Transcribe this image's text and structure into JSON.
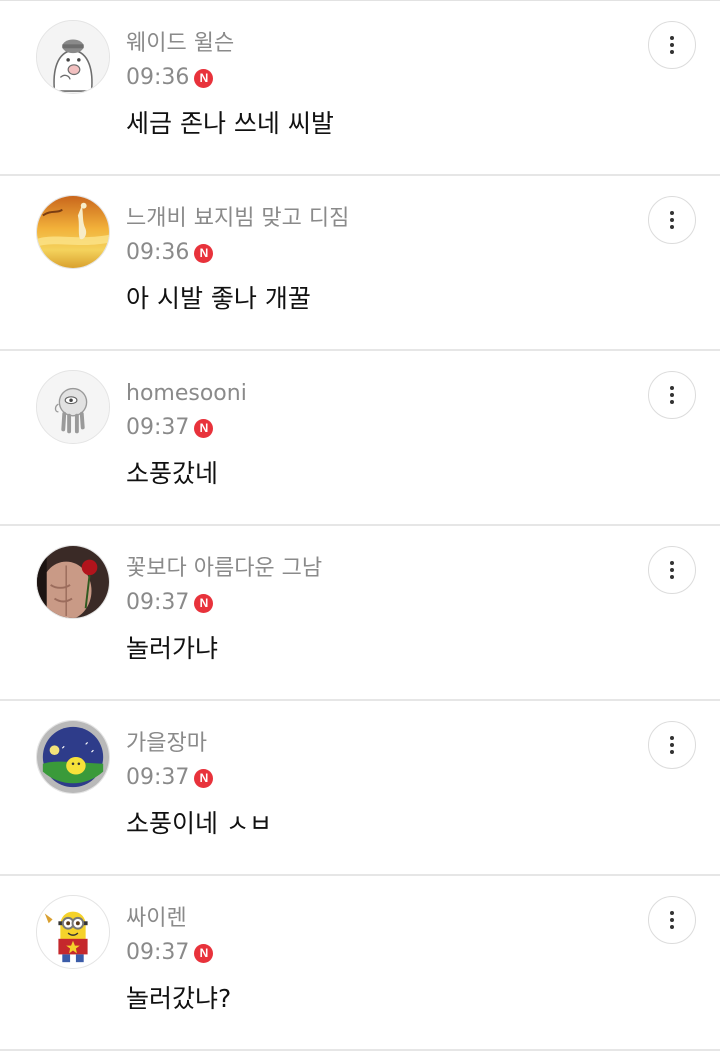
{
  "comments": [
    {
      "author": "웨이드 윌슨",
      "time": "09:36",
      "badge": "N",
      "text": "세금 존나 쓰네 씨발",
      "avatar_icon": "bear-doodle-avatar"
    },
    {
      "author": "느개비 뵤지빔 맞고 디짐",
      "time": "09:36",
      "badge": "N",
      "text": "아 시발 좋나 개꿀",
      "avatar_icon": "sunset-figure-avatar"
    },
    {
      "author": "homesooni",
      "time": "09:37",
      "badge": "N",
      "text": "소풍갔네",
      "avatar_icon": "cyclops-doodle-avatar"
    },
    {
      "author": "꽃보다 아름다운 그남",
      "time": "09:37",
      "badge": "N",
      "text": "놀러가냐",
      "avatar_icon": "rose-photo-avatar"
    },
    {
      "author": "가을장마",
      "time": "09:37",
      "badge": "N",
      "text": "소풍이네 ㅅㅂ",
      "avatar_icon": "chick-night-avatar"
    },
    {
      "author": "싸이렌",
      "time": "09:37",
      "badge": "N",
      "text": "놀러갔냐?",
      "avatar_icon": "minion-avatar"
    }
  ],
  "colors": {
    "badge": "#e8323b",
    "meta_text": "#8a8a8a",
    "body_text": "#111111",
    "divider": "#e6e6e6"
  }
}
